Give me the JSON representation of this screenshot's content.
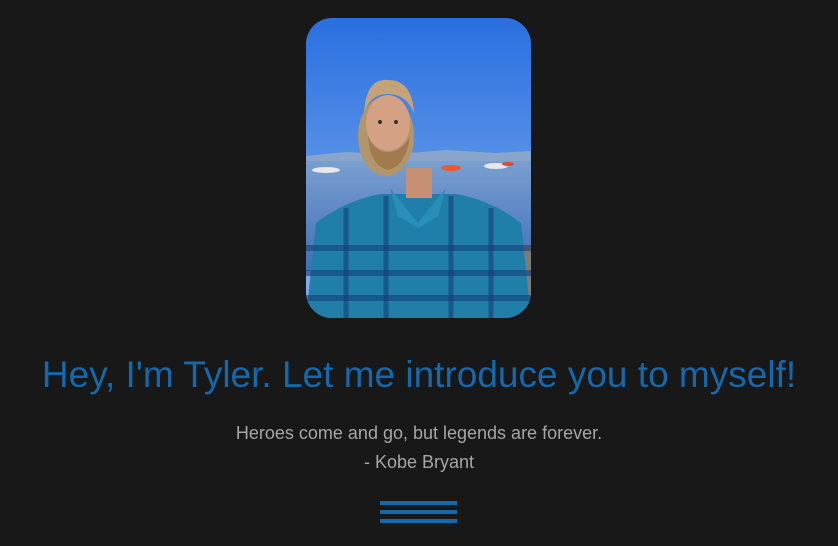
{
  "profile": {
    "photo_alt": "Tyler",
    "headline": "Hey, I'm Tyler. Let me introduce you to myself!",
    "quote": "Heroes come and go, but legends are forever.",
    "quote_author": "- Kobe Bryant"
  },
  "nav": {
    "menu_icon": "hamburger-menu-icon"
  },
  "colors": {
    "background": "#181818",
    "accent": "#1468ab",
    "muted_text": "#a6a6a6"
  }
}
